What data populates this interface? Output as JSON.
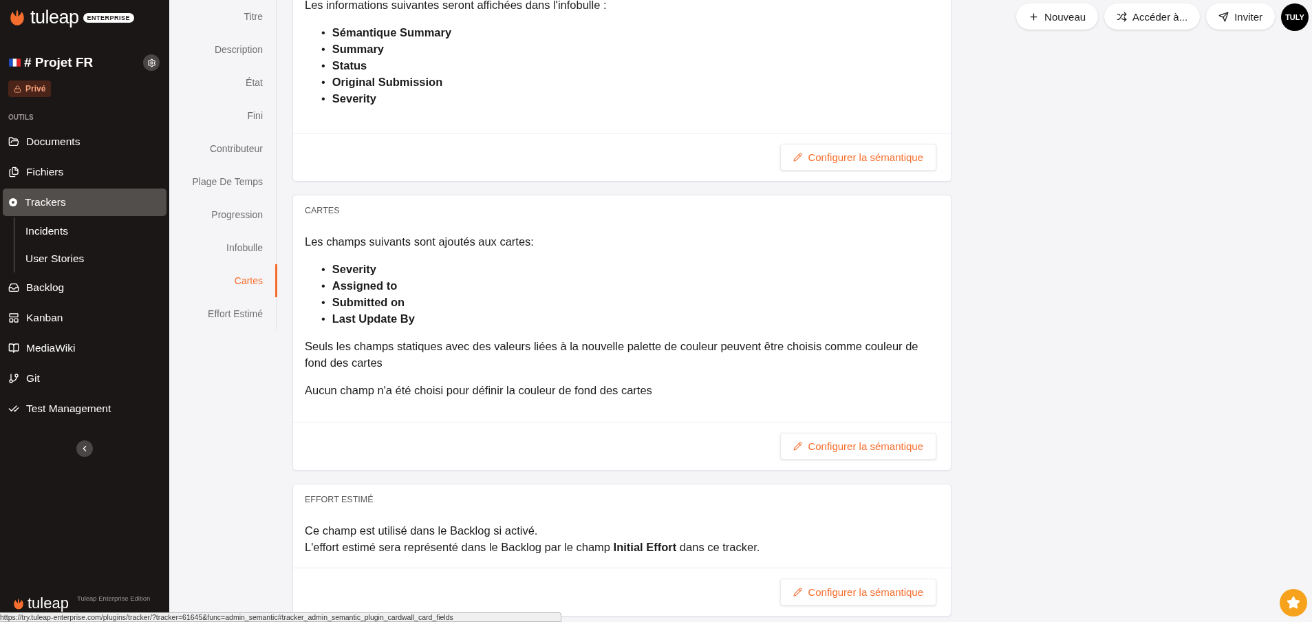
{
  "sidebar": {
    "logo_text": "tuleap",
    "edition_badge": "ENTERPRISE",
    "project_name": "# Projet FR",
    "privacy_badge": "Privé",
    "section_label": "OUTILS",
    "items": [
      {
        "label": "Documents",
        "selected": false
      },
      {
        "label": "Fichiers",
        "selected": false
      },
      {
        "label": "Trackers",
        "selected": true,
        "children": [
          {
            "label": "Incidents",
            "selected": false
          },
          {
            "label": "User Stories",
            "selected": false
          }
        ]
      },
      {
        "label": "Backlog",
        "selected": false
      },
      {
        "label": "Kanban",
        "selected": false
      },
      {
        "label": "MediaWiki",
        "selected": false
      },
      {
        "label": "Git",
        "selected": false
      },
      {
        "label": "Test Management",
        "selected": false
      }
    ],
    "footer_logo_text": "tuleap",
    "footer_edition": "Tuleap Enterprise Edition"
  },
  "semantic_nav": [
    {
      "label": "Titre",
      "selected": false
    },
    {
      "label": "Description",
      "selected": false
    },
    {
      "label": "État",
      "selected": false
    },
    {
      "label": "Fini",
      "selected": false
    },
    {
      "label": "Contributeur",
      "selected": false
    },
    {
      "label": "Plage De Temps",
      "selected": false
    },
    {
      "label": "Progression",
      "selected": false
    },
    {
      "label": "Infobulle",
      "selected": false
    },
    {
      "label": "Cartes",
      "selected": true
    },
    {
      "label": "Effort Estimé",
      "selected": false
    }
  ],
  "top_actions": [
    {
      "label": "Nouveau"
    },
    {
      "label": "Accéder à..."
    },
    {
      "label": "Inviter"
    }
  ],
  "avatar": "TULY",
  "cards": [
    {
      "blocks": [
        {
          "kind": "text",
          "text": "Les informations suivantes seront affichées dans l'infobulle :"
        },
        {
          "kind": "list",
          "marker": "•",
          "items": [
            "Sémantique Summary",
            "Summary",
            "Status",
            "Original Submission",
            "Severity"
          ]
        }
      ],
      "button": "Configurer la sémantique"
    },
    {
      "title": "CARTES",
      "blocks": [
        {
          "kind": "text",
          "text": "Les champs suivants sont ajoutés aux cartes:"
        },
        {
          "kind": "list",
          "marker": "•",
          "items": [
            "Severity",
            "Assigned to",
            "Submitted on",
            "Last Update By"
          ]
        },
        {
          "kind": "text",
          "text": "Seuls les champs statiques avec des valeurs liées à la nouvelle palette de couleur peuvent être choisis comme couleur de fond des cartes"
        },
        {
          "kind": "text",
          "text": "Aucun champ n'a été choisi pour définir la couleur de fond des cartes"
        }
      ],
      "button": "Configurer la sémantique"
    },
    {
      "title": "EFFORT ESTIMÉ",
      "blocks": [
        {
          "kind": "lines",
          "lines": [
            "Ce champ est utilisé dans le Backlog si activé.",
            "L'effort estimé sera représenté dans le Backlog par le champ **Initial Effort** dans ce tracker."
          ]
        }
      ],
      "button": "Configurer la sémantique"
    }
  ],
  "status_url": "https://try.tuleap-enterprise.com/plugins/tracker/?tracker=61645&func=admin_semantic#tracker_admin_semantic_plugin_cardwall_card_fields"
}
